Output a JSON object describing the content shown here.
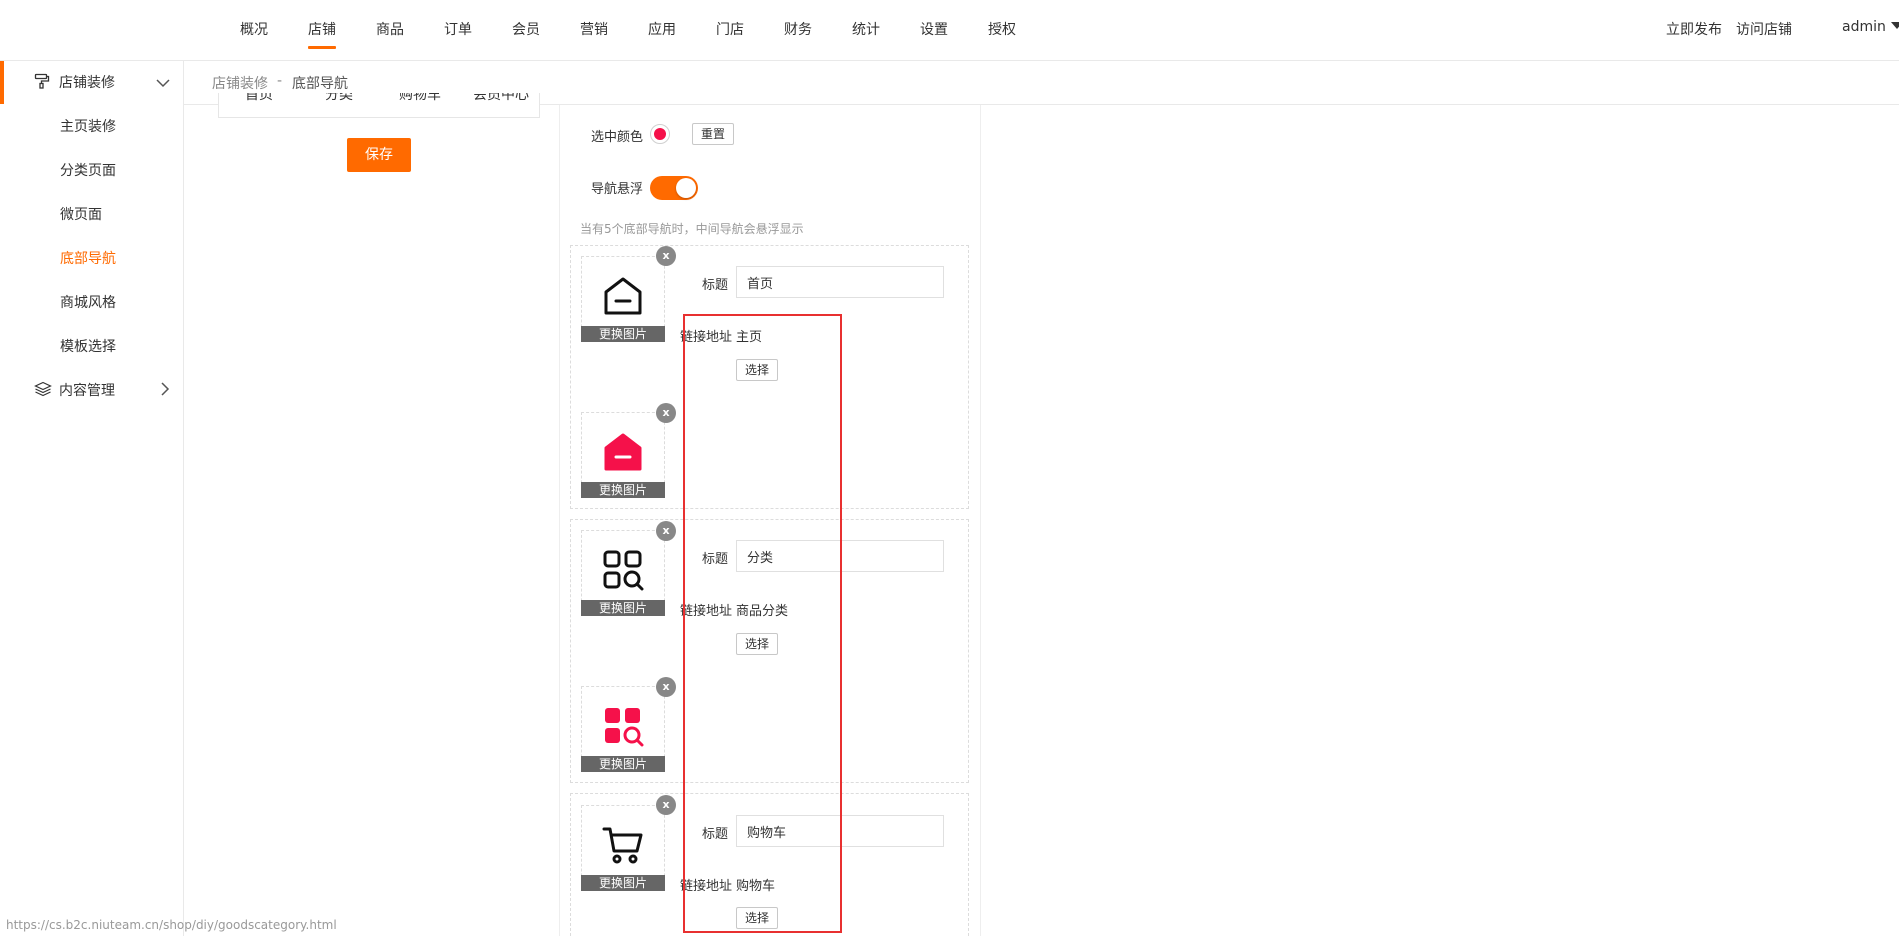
{
  "colors": {
    "accent": "#ff6a00",
    "icon_red": "#f5114a",
    "highlight_red": "#e83030"
  },
  "topnav": {
    "items": [
      {
        "label": "概况"
      },
      {
        "label": "店铺"
      },
      {
        "label": "商品"
      },
      {
        "label": "订单"
      },
      {
        "label": "会员"
      },
      {
        "label": "营销"
      },
      {
        "label": "应用"
      },
      {
        "label": "门店"
      },
      {
        "label": "财务"
      },
      {
        "label": "统计"
      },
      {
        "label": "设置"
      },
      {
        "label": "授权"
      }
    ],
    "active": "店铺",
    "publish_label": "立即发布",
    "visit_label": "访问店铺",
    "user_label": "admin"
  },
  "sidebar": {
    "group1": {
      "label": "店铺装修",
      "icon": "paint-roller-icon",
      "items": [
        {
          "label": "主页装修"
        },
        {
          "label": "分类页面"
        },
        {
          "label": "微页面"
        },
        {
          "label": "底部导航"
        },
        {
          "label": "商城风格"
        },
        {
          "label": "模板选择"
        }
      ],
      "active": "底部导航"
    },
    "group2": {
      "label": "内容管理",
      "icon": "layers-icon"
    }
  },
  "breadcrumb": {
    "parent": "店铺装修",
    "separator": "-",
    "current": "底部导航"
  },
  "preview": {
    "tabs": [
      {
        "label": "首页"
      },
      {
        "label": "分类"
      },
      {
        "label": "购物车"
      },
      {
        "label": "会员中心"
      }
    ],
    "save_label": "保存"
  },
  "settings": {
    "selected_color_label": "选中颜色",
    "selected_color": "#f5114a",
    "reset_label": "重置",
    "float_label": "导航悬浮",
    "float_on": true,
    "float_hint": "当有5个底部导航时，中间导航会悬浮显示"
  },
  "nav_items": [
    {
      "title_label": "标题",
      "title_value": "首页",
      "link_label": "链接地址",
      "link_value": "主页",
      "select_label": "选择",
      "replace_label": "更换图片",
      "close_label": "x",
      "icon": "home-icon"
    },
    {
      "title_label": "标题",
      "title_value": "分类",
      "link_label": "链接地址",
      "link_value": "商品分类",
      "select_label": "选择",
      "replace_label": "更换图片",
      "close_label": "x",
      "icon": "category-search-icon"
    },
    {
      "title_label": "标题",
      "title_value": "购物车",
      "link_label": "链接地址",
      "link_value": "购物车",
      "select_label": "选择",
      "replace_label": "更换图片",
      "close_label": "x",
      "icon": "cart-icon"
    }
  ],
  "status_url": "https://cs.b2c.niuteam.cn/shop/diy/goodscategory.html"
}
